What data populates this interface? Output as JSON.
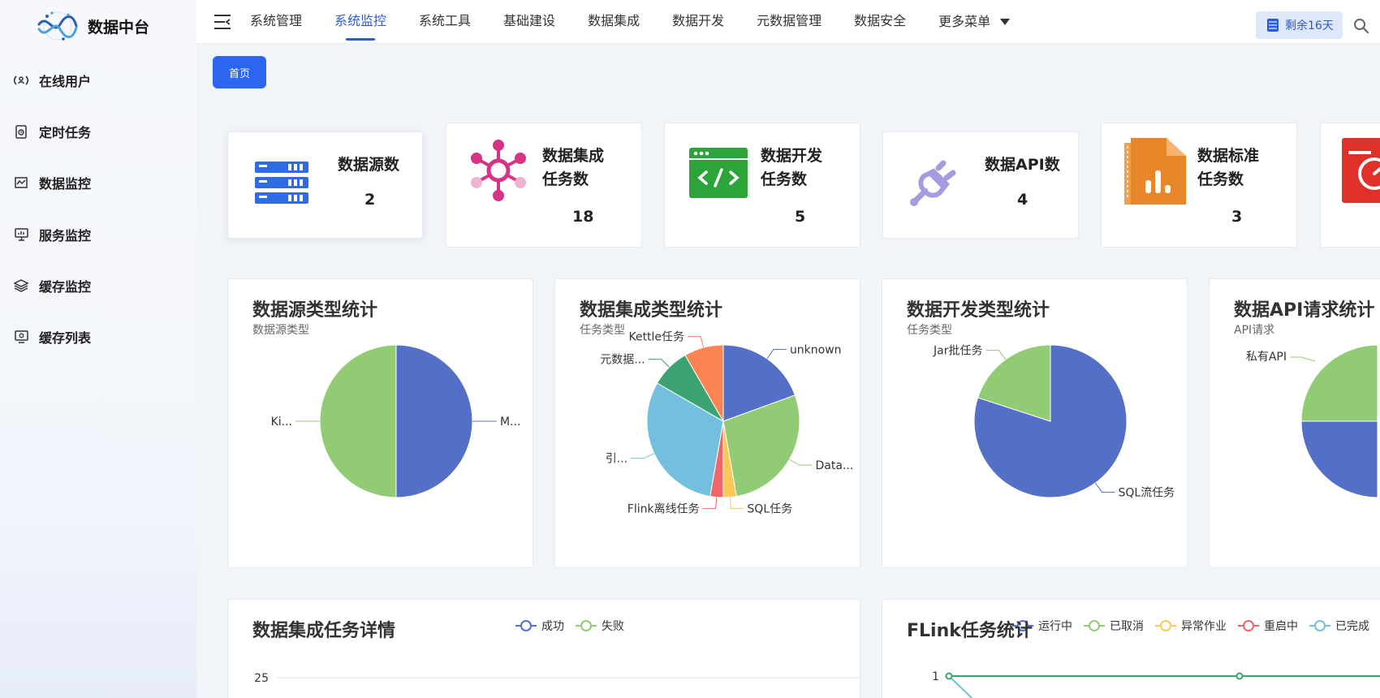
{
  "app": {
    "title": "数据中台"
  },
  "sidebar": {
    "items": [
      {
        "label": "在线用户",
        "icon": "online-users-icon"
      },
      {
        "label": "定时任务",
        "icon": "scheduled-task-icon"
      },
      {
        "label": "数据监控",
        "icon": "data-monitor-icon"
      },
      {
        "label": "服务监控",
        "icon": "service-monitor-icon"
      },
      {
        "label": "缓存监控",
        "icon": "cache-monitor-icon"
      },
      {
        "label": "缓存列表",
        "icon": "cache-list-icon"
      }
    ]
  },
  "topnav": {
    "items": [
      "系统管理",
      "系统监控",
      "系统工具",
      "基础建设",
      "数据集成",
      "数据开发",
      "元数据管理",
      "数据安全"
    ],
    "active": "系统监控",
    "more_label": "更多菜单"
  },
  "header": {
    "remaining_label": "剩余16天"
  },
  "breadcrumb": {
    "home_label": "首页"
  },
  "stats": [
    {
      "title_lines": [
        "数据源数"
      ],
      "value": "2",
      "icon": "database-server-icon"
    },
    {
      "title_lines": [
        "数据集成",
        "任务数"
      ],
      "value": "18",
      "icon": "integration-hub-icon"
    },
    {
      "title_lines": [
        "数据开发",
        "任务数"
      ],
      "value": "5",
      "icon": "code-window-icon"
    },
    {
      "title_lines": [
        "数据API数"
      ],
      "value": "4",
      "icon": "plug-link-icon"
    },
    {
      "title_lines": [
        "数据标准",
        "任务数"
      ],
      "value": "3",
      "icon": "standard-doc-chart-icon"
    }
  ],
  "chart_data": [
    {
      "type": "pie",
      "title": "数据源类型统计",
      "subtitle": "数据源类型",
      "slices": [
        {
          "label": "M...",
          "value": 1
        },
        {
          "label": "Ki...",
          "value": 1
        }
      ]
    },
    {
      "type": "pie",
      "title": "数据集成类型统计",
      "subtitle": "任务类型",
      "slices": [
        {
          "label": "unknown",
          "value": 3.5
        },
        {
          "label": "Data...",
          "value": 5
        },
        {
          "label": "SQL任务",
          "value": 0.5
        },
        {
          "label": "Flink离线任务",
          "value": 0.5
        },
        {
          "label": "引...",
          "value": 5.5
        },
        {
          "label": "元数据...",
          "value": 1.5
        },
        {
          "label": "Kettle任务",
          "value": 1.5
        }
      ]
    },
    {
      "type": "pie",
      "title": "数据开发类型统计",
      "subtitle": "任务类型",
      "slices": [
        {
          "label": "SQL流任务",
          "value": 4
        },
        {
          "label": "Jar批任务",
          "value": 1
        }
      ]
    },
    {
      "type": "pie",
      "title": "数据API请求统计",
      "subtitle": "API请求",
      "slices": [
        {
          "label": "私有API",
          "value": 1
        }
      ]
    },
    {
      "type": "line",
      "title": "数据集成任务详情",
      "series": [
        {
          "name": "成功"
        },
        {
          "name": "失败"
        }
      ],
      "ytick_labels": [
        "25"
      ]
    },
    {
      "type": "line",
      "title": "FLink任务统计",
      "series": [
        {
          "name": "运行中"
        },
        {
          "name": "已取消"
        },
        {
          "name": "异常作业"
        },
        {
          "name": "重启中"
        },
        {
          "name": "已完成"
        }
      ],
      "ytick_labels": [
        "1"
      ]
    }
  ],
  "colors": {
    "accent": "#2c66f0",
    "pie": [
      "#5470c6",
      "#91cc75",
      "#fac858",
      "#ee6666",
      "#73c0de",
      "#3ba272",
      "#fc8452"
    ]
  }
}
